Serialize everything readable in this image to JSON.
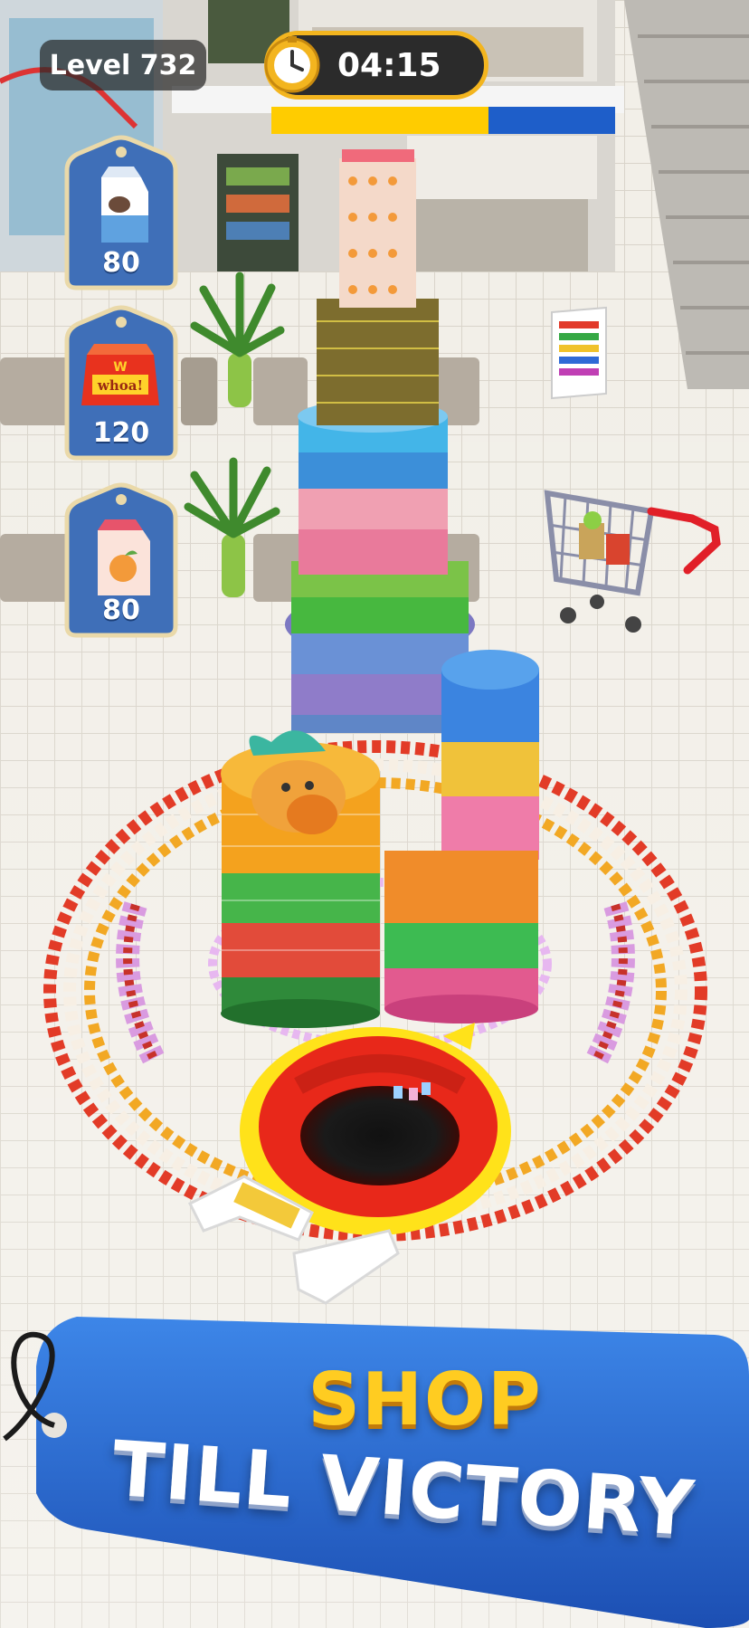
{
  "hud": {
    "level_label": "Level 732",
    "timer": "04:15"
  },
  "goals": [
    {
      "icon": "milk-carton-icon",
      "count": "80"
    },
    {
      "icon": "whoa-snack-box-icon",
      "count": "120",
      "box_text": "whoa!"
    },
    {
      "icon": "peach-juice-carton-icon",
      "count": "80"
    }
  ],
  "banner": {
    "line1": "SHOP",
    "line2": "TILL VICTORY"
  },
  "colors": {
    "tag_blue": "#3f6fb8",
    "banner_blue": "#2a63c9",
    "hole_red": "#e8281a",
    "hole_yellow": "#ffe21a",
    "title_yellow": "#ffcc21"
  }
}
